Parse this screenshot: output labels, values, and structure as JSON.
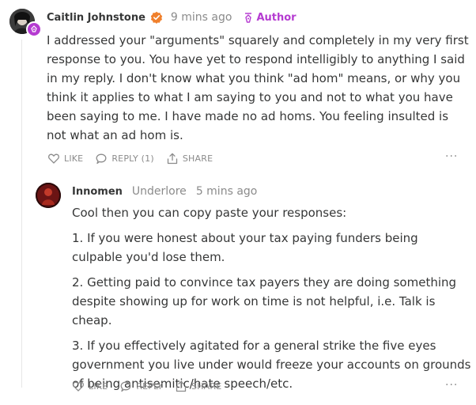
{
  "colors": {
    "text": "#363737",
    "muted": "#8b8b8b",
    "author_accent": "#b53bd1",
    "verified": "#f0802c"
  },
  "comments": [
    {
      "name": "Caitlin Johnstone",
      "verified_icon": "verified-check-icon",
      "time": "9 mins ago",
      "author_tag": "Author",
      "body": "I addressed your \"arguments\" squarely and completely in my very first response to you. You have yet to respond intelligibly to anything I said in my reply. I don't know what you think \"ad hom\" means, or why you think it applies to what I am saying to you and not to what you have been saying to me. I have made no ad homs. You feeling insulted is not what an ad hom is.",
      "actions": {
        "like": "LIKE",
        "reply": "REPLY (1)",
        "share": "SHARE"
      }
    },
    {
      "name": "Innomen",
      "subtitle": "Underlore",
      "time": "5 mins ago",
      "paragraphs": [
        "Cool then you can copy paste your responses:",
        "1. If you were honest about your tax paying funders being culpable you'd lose them.",
        "2. Getting paid to convince tax payers they are doing something despite showing up for work on time is not helpful, i.e. Talk is cheap.",
        "3. If you effectively agitated for a general strike the five eyes government you live under would freeze your accounts on grounds of being antisemitic/hate speech/etc."
      ],
      "actions": {
        "like": "LIKE",
        "reply": "REPLY",
        "share": "SHARE"
      }
    }
  ],
  "more_label": "···"
}
